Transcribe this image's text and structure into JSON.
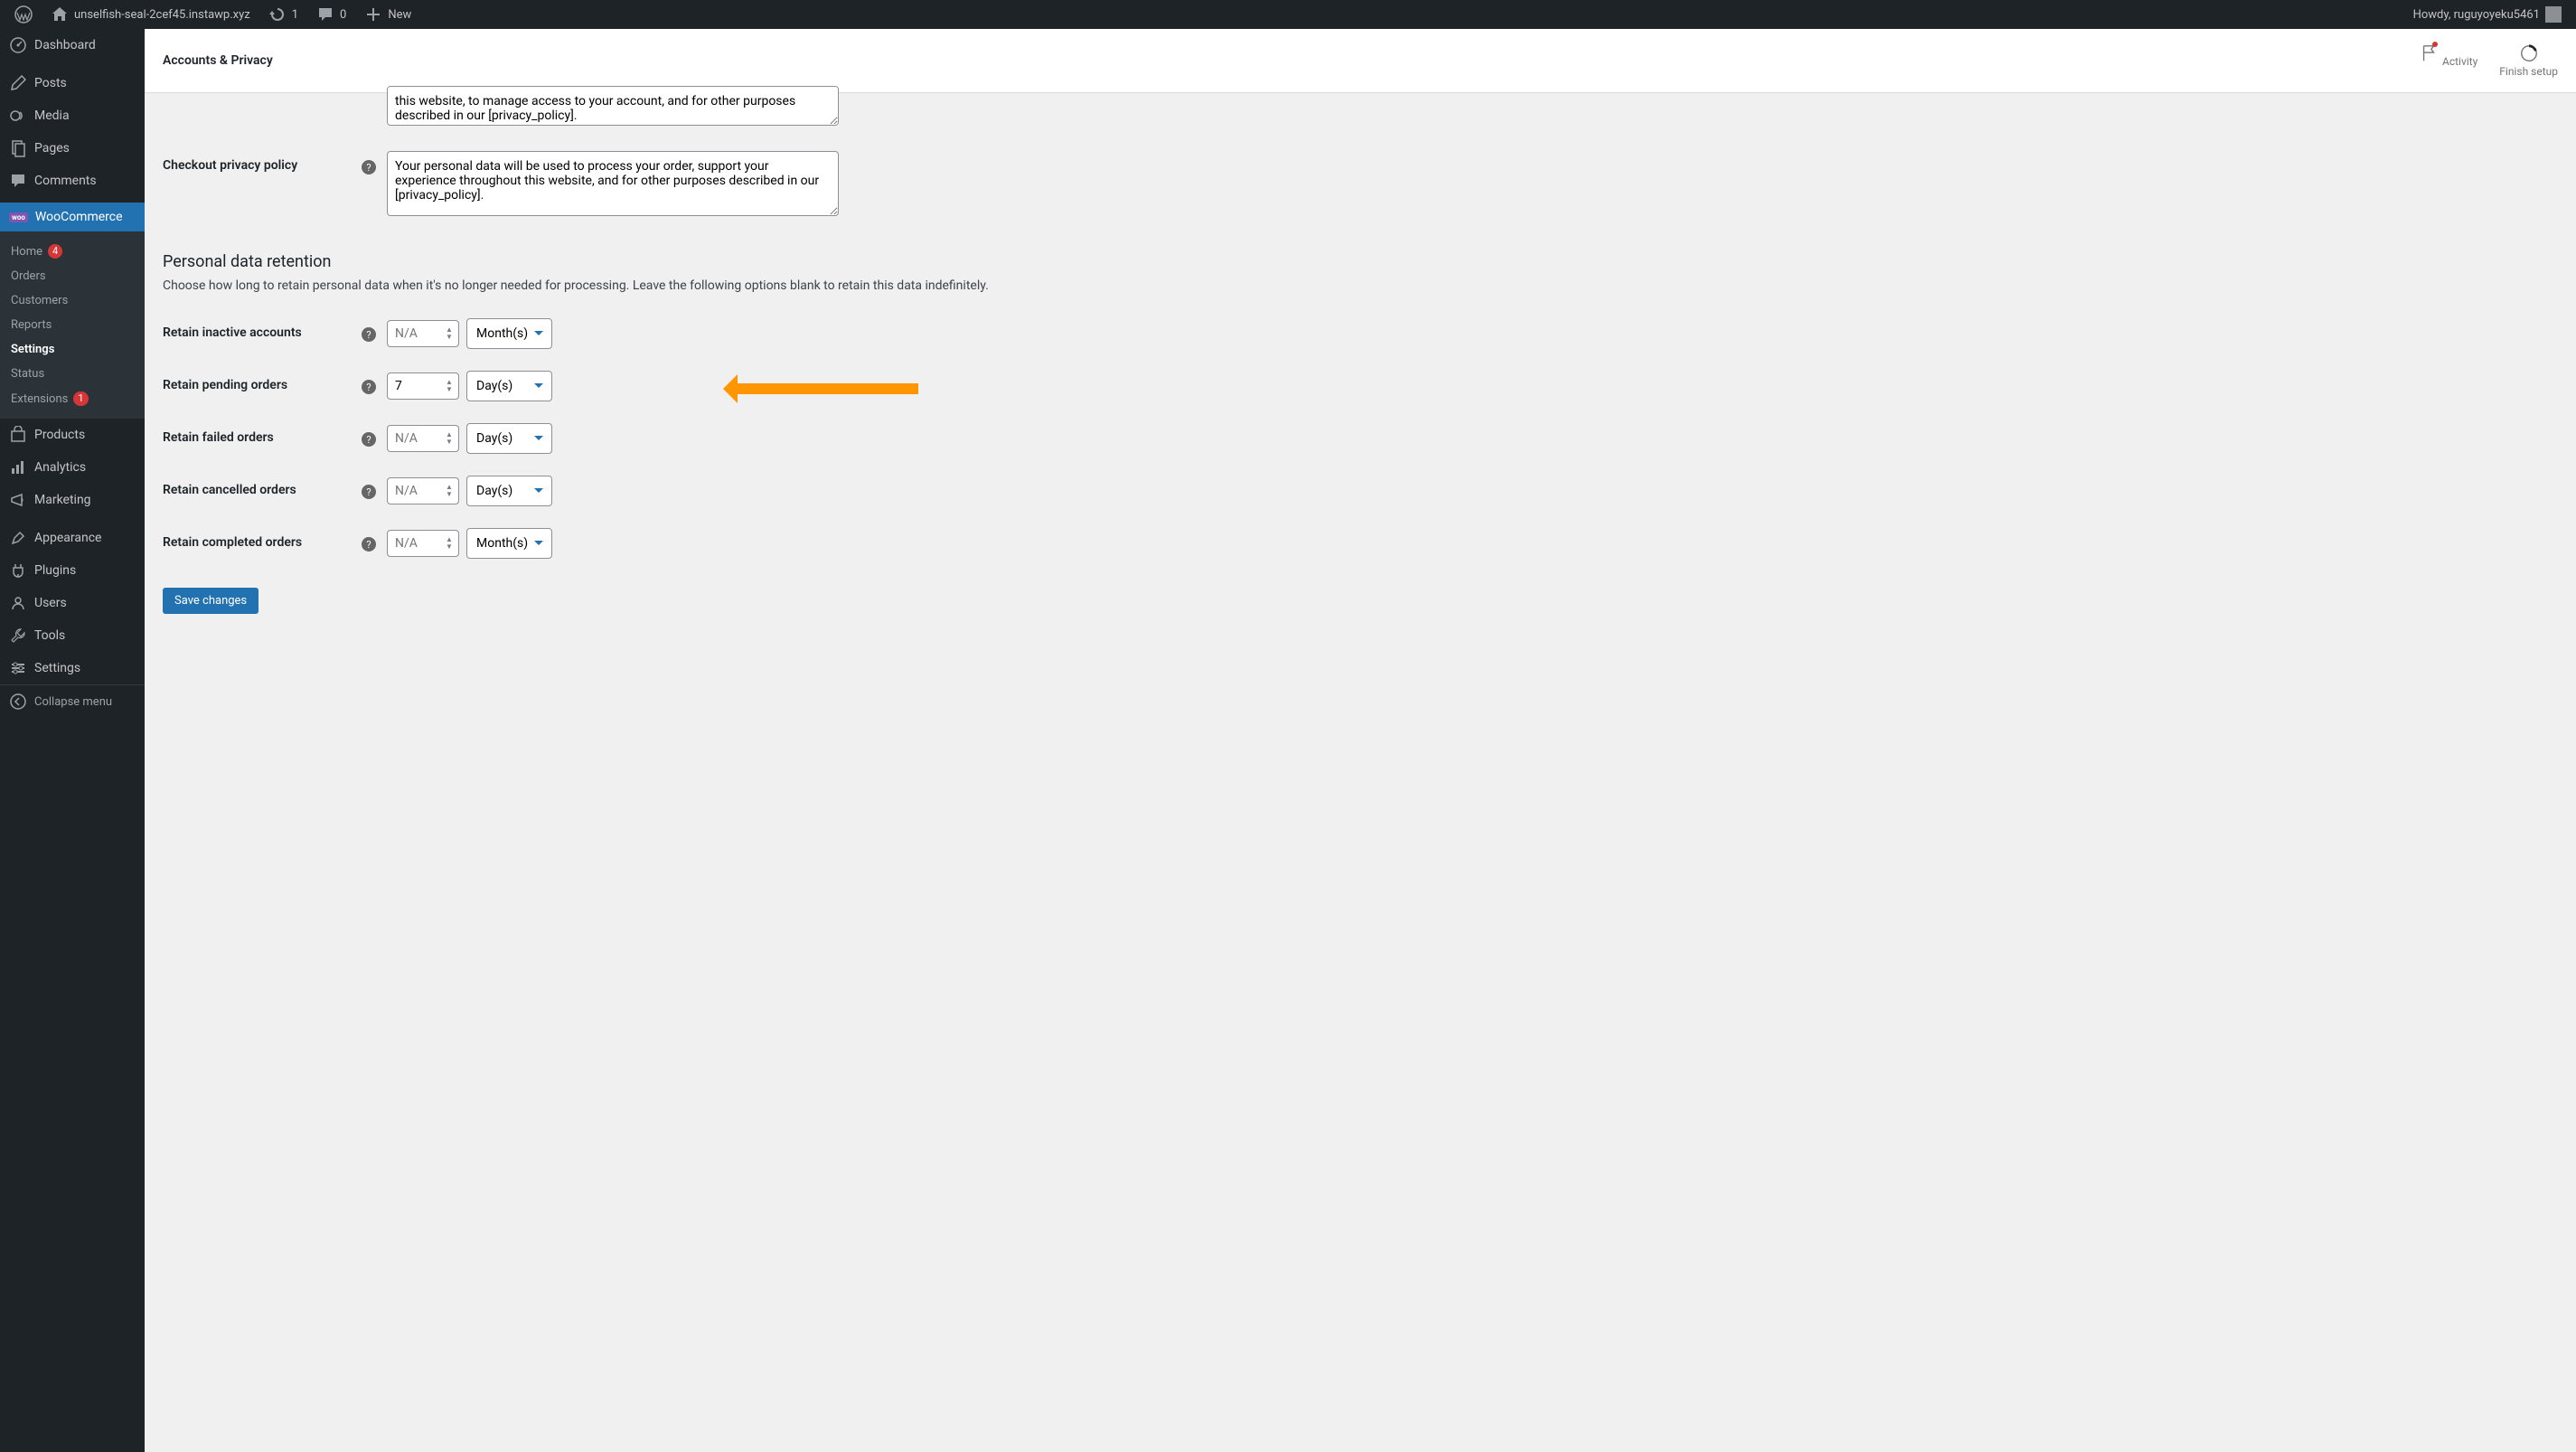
{
  "adminbar": {
    "site_name": "unselfish-seal-2cef45.instawp.xyz",
    "updates": "1",
    "comments": "0",
    "new": "New",
    "howdy": "Howdy, ruguyoyeku5461"
  },
  "sidebar": {
    "dashboard": "Dashboard",
    "posts": "Posts",
    "media": "Media",
    "pages": "Pages",
    "comments_m": "Comments",
    "woocommerce": "WooCommerce",
    "products": "Products",
    "analytics": "Analytics",
    "marketing": "Marketing",
    "appearance": "Appearance",
    "plugins": "Plugins",
    "users": "Users",
    "tools": "Tools",
    "settings": "Settings",
    "collapse": "Collapse menu",
    "woo_sub": {
      "home": "Home",
      "home_badge": "4",
      "orders": "Orders",
      "customers": "Customers",
      "reports": "Reports",
      "settings": "Settings",
      "status": "Status",
      "extensions": "Extensions",
      "ext_badge": "1"
    }
  },
  "header": {
    "title": "Accounts & Privacy",
    "activity": "Activity",
    "finish": "Finish setup"
  },
  "form": {
    "registration_value": "this website, to manage access to your account, and for other purposes described in our [privacy_policy].",
    "checkout_label": "Checkout privacy policy",
    "checkout_value": "Your personal data will be used to process your order, support your experience throughout this website, and for other purposes described in our [privacy_policy].",
    "retention_title": "Personal data retention",
    "retention_desc": "Choose how long to retain personal data when it's no longer needed for processing. Leave the following options blank to retain this data indefinitely.",
    "na_placeholder": "N/A",
    "rows": {
      "inactive": {
        "label": "Retain inactive accounts",
        "value": "",
        "unit": "Month(s)"
      },
      "pending": {
        "label": "Retain pending orders",
        "value": "7",
        "unit": "Day(s)"
      },
      "failed": {
        "label": "Retain failed orders",
        "value": "",
        "unit": "Day(s)"
      },
      "cancelled": {
        "label": "Retain cancelled orders",
        "value": "",
        "unit": "Day(s)"
      },
      "completed": {
        "label": "Retain completed orders",
        "value": "",
        "unit": "Month(s)"
      }
    },
    "save": "Save changes"
  }
}
